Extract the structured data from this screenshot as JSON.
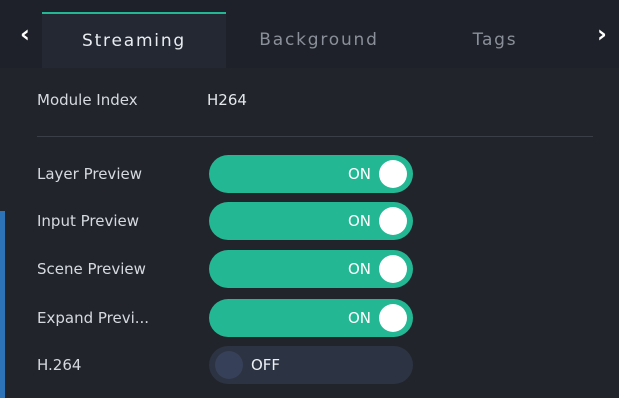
{
  "tabs": {
    "prev_arrow": "‹",
    "next_arrow": "›",
    "items": [
      {
        "label": "Streaming",
        "active": true
      },
      {
        "label": "Background",
        "active": false
      },
      {
        "label": "Tags",
        "active": false
      }
    ]
  },
  "module": {
    "label": "Module Index",
    "value": "H264"
  },
  "settings": [
    {
      "label": "Layer Preview",
      "state": "ON"
    },
    {
      "label": "Input Preview",
      "state": "ON"
    },
    {
      "label": "Scene Preview",
      "state": "ON"
    },
    {
      "label": "Expand Previ...",
      "state": "ON"
    },
    {
      "label": "H.264",
      "state": "OFF"
    }
  ],
  "colors": {
    "accent": "#23b793",
    "toggle_off": "#2c3342",
    "side_accent": "#2d73b8"
  }
}
